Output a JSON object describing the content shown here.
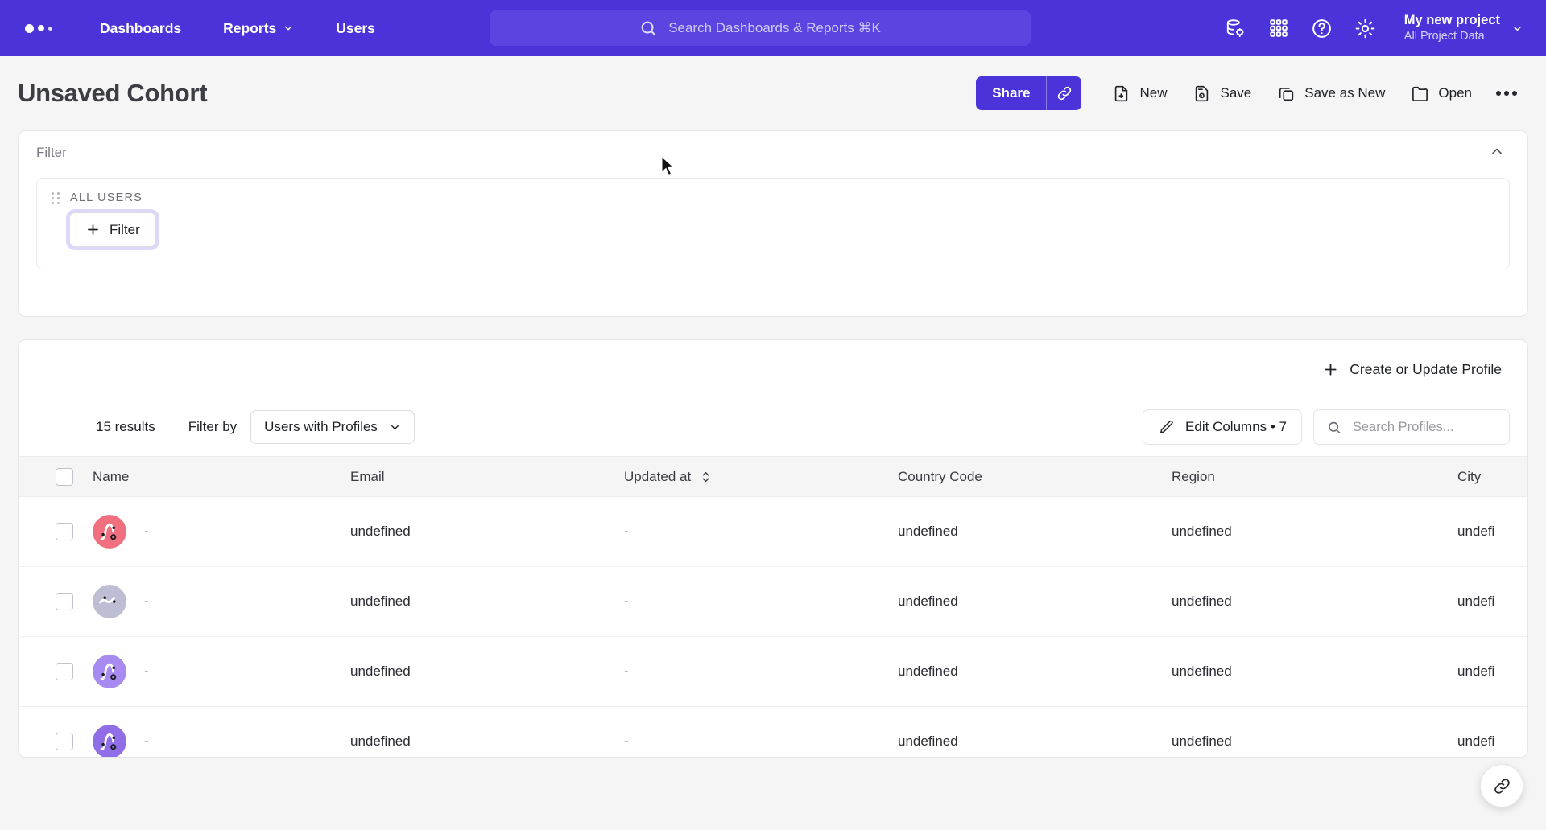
{
  "header": {
    "logo": "mixpanel-logo",
    "nav": [
      {
        "label": "Dashboards",
        "icon": null
      },
      {
        "label": "Reports",
        "icon": "chevron-down-icon"
      },
      {
        "label": "Users",
        "icon": null
      }
    ],
    "search": {
      "placeholder": "Search Dashboards & Reports ⌘K",
      "icon": "search-icon"
    },
    "icons": [
      {
        "name": "database-settings-icon"
      },
      {
        "name": "apps-grid-icon"
      },
      {
        "name": "help-circle-icon"
      },
      {
        "name": "gear-icon"
      }
    ],
    "project": {
      "name": "My new project",
      "subtitle": "All Project Data",
      "chevron": "chevron-down-icon"
    },
    "accent_color": "#4a34d9",
    "search_bg": "#5a45e0"
  },
  "title_bar": {
    "title": "Unsaved Cohort",
    "share_label": "Share",
    "share_link_icon": "link-icon",
    "actions": [
      {
        "label": "New",
        "icon": "file-plus-icon"
      },
      {
        "label": "Save",
        "icon": "save-disk-icon"
      },
      {
        "label": "Save as New",
        "icon": "copy-icon"
      },
      {
        "label": "Open",
        "icon": "folder-icon"
      }
    ],
    "overflow_icon": "more-horizontal-icon"
  },
  "filter_panel": {
    "label": "Filter",
    "collapse_icon": "chevron-up-icon",
    "group_label": "ALL USERS",
    "drag_handle_icon": "drag-dots-icon",
    "add_filter_label": "Filter",
    "add_filter_icon": "plus-icon",
    "focus_ring_color": "#ddd7f9"
  },
  "profiles": {
    "create_button": {
      "label": "Create or Update Profile",
      "icon": "plus-icon"
    },
    "results_count": "15 results",
    "filter_by_label": "Filter by",
    "filter_select": {
      "value": "Users with Profiles",
      "icon": "chevron-down-icon"
    },
    "edit_columns": {
      "label": "Edit Columns • 7",
      "icon": "pencil-icon"
    },
    "search": {
      "placeholder": "Search Profiles...",
      "value": "",
      "icon": "search-icon"
    },
    "columns": [
      {
        "key": "check",
        "label": ""
      },
      {
        "key": "name",
        "label": "Name"
      },
      {
        "key": "email",
        "label": "Email"
      },
      {
        "key": "updated_at",
        "label": "Updated at",
        "sortable": true
      },
      {
        "key": "country_code",
        "label": "Country Code"
      },
      {
        "key": "region",
        "label": "Region"
      },
      {
        "key": "city",
        "label": "City"
      }
    ],
    "rows": [
      {
        "avatar_color": "#f1707f",
        "avatar_style": "squiggle-up",
        "name": "-",
        "email": "undefined",
        "updated_at": "-",
        "country_code": "undefined",
        "region": "undefined",
        "city": "undefi"
      },
      {
        "avatar_color": "#bdbdd4",
        "avatar_style": "squiggle-zigzag",
        "name": "-",
        "email": "undefined",
        "updated_at": "-",
        "country_code": "undefined",
        "region": "undefined",
        "city": "undefi"
      },
      {
        "avatar_color": "#a78bf0",
        "avatar_style": "squiggle-up",
        "name": "-",
        "email": "undefined",
        "updated_at": "-",
        "country_code": "undefined",
        "region": "undefined",
        "city": "undefi"
      },
      {
        "avatar_color": "#8f6ee8",
        "avatar_style": "squiggle-up",
        "name": "-",
        "email": "undefined",
        "updated_at": "-",
        "country_code": "undefined",
        "region": "undefined",
        "city": "undefi"
      }
    ]
  },
  "floating": {
    "help_icon": "link-icon"
  }
}
